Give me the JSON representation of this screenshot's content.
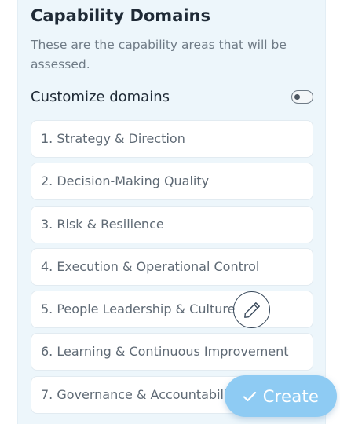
{
  "section": {
    "title": "Capability Domains",
    "subtitle": "These are the capability areas that will be assessed.",
    "customize_label": "Customize domains",
    "customize_enabled": false
  },
  "domains": [
    {
      "label": "1. Strategy & Direction"
    },
    {
      "label": "2. Decision-Making Quality"
    },
    {
      "label": "3. Risk & Resilience"
    },
    {
      "label": "4. Execution & Operational Control"
    },
    {
      "label": "5. People Leadership & Culture"
    },
    {
      "label": "6. Learning & Continuous Improvement"
    },
    {
      "label": "7. Governance & Accountability"
    }
  ],
  "actions": {
    "edit_icon": "pencil-icon",
    "create_label": "Create",
    "create_icon": "check-icon"
  },
  "colors": {
    "panel_bg": "#edf6fb",
    "create_button": "#8ecbf3"
  }
}
